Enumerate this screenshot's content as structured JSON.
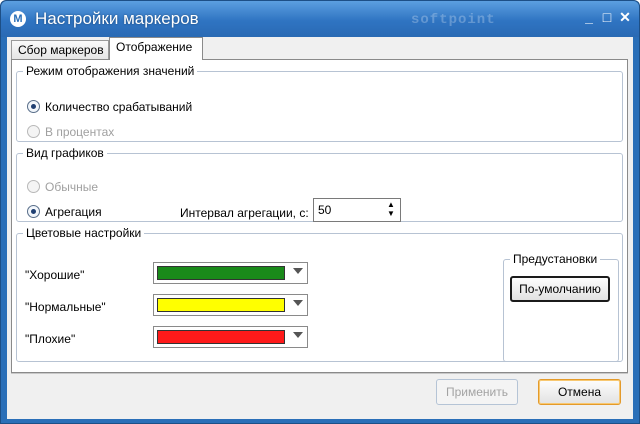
{
  "window": {
    "title": "Настройки маркеров",
    "watermark": "softpoint",
    "app_icon": "app-logo-icon",
    "accent_color": "#2a6fb8"
  },
  "tabs": [
    {
      "label": "Сбор маркеров",
      "active": false
    },
    {
      "label": "Отображение",
      "active": true
    }
  ],
  "display_mode": {
    "legend": "Режим отображения значений",
    "options": [
      {
        "label": "Количество срабатываний",
        "checked": true,
        "enabled": true
      },
      {
        "label": "В процентах",
        "checked": false,
        "enabled": false
      }
    ]
  },
  "chart_view": {
    "legend": "Вид графиков",
    "options": [
      {
        "label": "Обычные",
        "checked": false,
        "enabled": false
      },
      {
        "label": "Агрегация",
        "checked": true,
        "enabled": true
      }
    ],
    "interval_label": "Интервал агрегации, с:",
    "interval_value": "50"
  },
  "color_settings": {
    "legend": "Цветовые настройки",
    "items": [
      {
        "label": "\"Хорошие\"",
        "color": "#1a8a1a"
      },
      {
        "label": "\"Нормальные\"",
        "color": "#ffff00"
      },
      {
        "label": "\"Плохие\"",
        "color": "#ff1a1a"
      }
    ],
    "presets": {
      "legend": "Предустановки",
      "default_button": "По-умолчанию"
    }
  },
  "footer": {
    "apply_button": "Применить",
    "cancel_button": "Отмена"
  }
}
